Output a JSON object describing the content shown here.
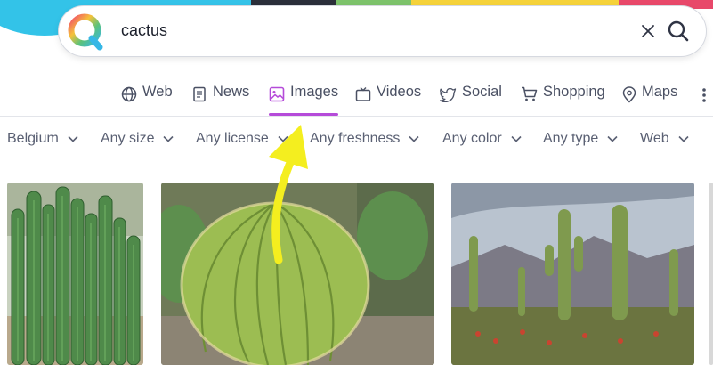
{
  "search": {
    "query": "cactus",
    "clear_icon": "close-icon",
    "search_icon": "search-icon"
  },
  "tabs": [
    {
      "label": "Web",
      "icon": "globe-icon"
    },
    {
      "label": "News",
      "icon": "newspaper-icon"
    },
    {
      "label": "Images",
      "icon": "image-icon",
      "active": true
    },
    {
      "label": "Videos",
      "icon": "tv-icon"
    },
    {
      "label": "Social",
      "icon": "bird-icon"
    },
    {
      "label": "Shopping",
      "icon": "cart-icon"
    },
    {
      "label": "Maps",
      "icon": "map-pin-icon"
    }
  ],
  "filters": [
    {
      "label": "Belgium"
    },
    {
      "label": "Any size"
    },
    {
      "label": "Any license"
    },
    {
      "label": "Any freshness"
    },
    {
      "label": "Any color"
    },
    {
      "label": "Any type"
    },
    {
      "label": "Web"
    }
  ],
  "colors": {
    "accent": "#b54bd9",
    "annotation_arrow": "#f4ee1f"
  }
}
